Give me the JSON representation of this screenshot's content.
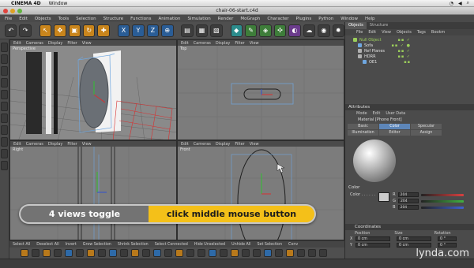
{
  "mac_menu": {
    "app_name": "CINEMA 4D",
    "items": [
      "Window"
    ]
  },
  "window": {
    "title": "chair-06-start.c4d"
  },
  "c4d_menu": [
    "File",
    "Edit",
    "Objects",
    "Tools",
    "Selection",
    "Structure",
    "Functions",
    "Animation",
    "Simulation",
    "Render",
    "MoGraph",
    "Character",
    "Plugins",
    "Python",
    "Window",
    "Help"
  ],
  "viewports": {
    "menu": [
      "Edit",
      "Cameras",
      "Display",
      "Filter",
      "View"
    ],
    "labels": [
      "Perspective",
      "Top",
      "Right",
      "Front"
    ]
  },
  "objects_panel": {
    "tabs": [
      "Objects",
      "Structure"
    ],
    "menu": [
      "File",
      "Edit",
      "View",
      "Objects",
      "Tags",
      "Bookm"
    ],
    "items": [
      {
        "name": "Null Object",
        "color": "#9ccf5b"
      },
      {
        "name": "Sofa",
        "color": "#6fa7e0"
      },
      {
        "name": "Ref Planes",
        "color": "#d0d0d0"
      },
      {
        "name": "HDRR",
        "color": "#d0d0d0"
      },
      {
        "name": "OE1",
        "color": "#6fa7e0"
      }
    ]
  },
  "attributes": {
    "title": "Attributes",
    "menu": [
      "Mode",
      "Edit",
      "User Data"
    ],
    "material_name": "Material [Phone Front]",
    "channel_tabs": [
      "Basic",
      "Color",
      "Specular",
      "Illumination",
      "Editor",
      "Assign"
    ],
    "active_tab": "Color",
    "color_section": "Color",
    "color_label": "Color . . . . . .",
    "rgb": [
      {
        "label": "R",
        "value": "204",
        "color": "#d84040"
      },
      {
        "label": "G",
        "value": "204",
        "color": "#40b040"
      },
      {
        "label": "B",
        "value": "204",
        "color": "#4060d0"
      }
    ]
  },
  "coordinates": {
    "title": "Coordinates",
    "columns": [
      "Position",
      "Size",
      "Rotation"
    ],
    "rows": [
      {
        "axis": "X",
        "pos": "0 cm",
        "size": "0 cm",
        "rot": "0 °"
      },
      {
        "axis": "Y",
        "pos": "0 cm",
        "size": "0 cm",
        "rot": "0 °"
      }
    ]
  },
  "bottom_bar": [
    "Select All",
    "Deselect All",
    "Invert",
    "Grow Selection",
    "Shrink Selection",
    "Select Connected",
    "Hide Unselected",
    "Unhide All",
    "Set Selection",
    "Conv"
  ],
  "overlay": {
    "left_text": "4 views toggle",
    "right_text": "click middle mouse button"
  },
  "watermark": "lynda.com"
}
